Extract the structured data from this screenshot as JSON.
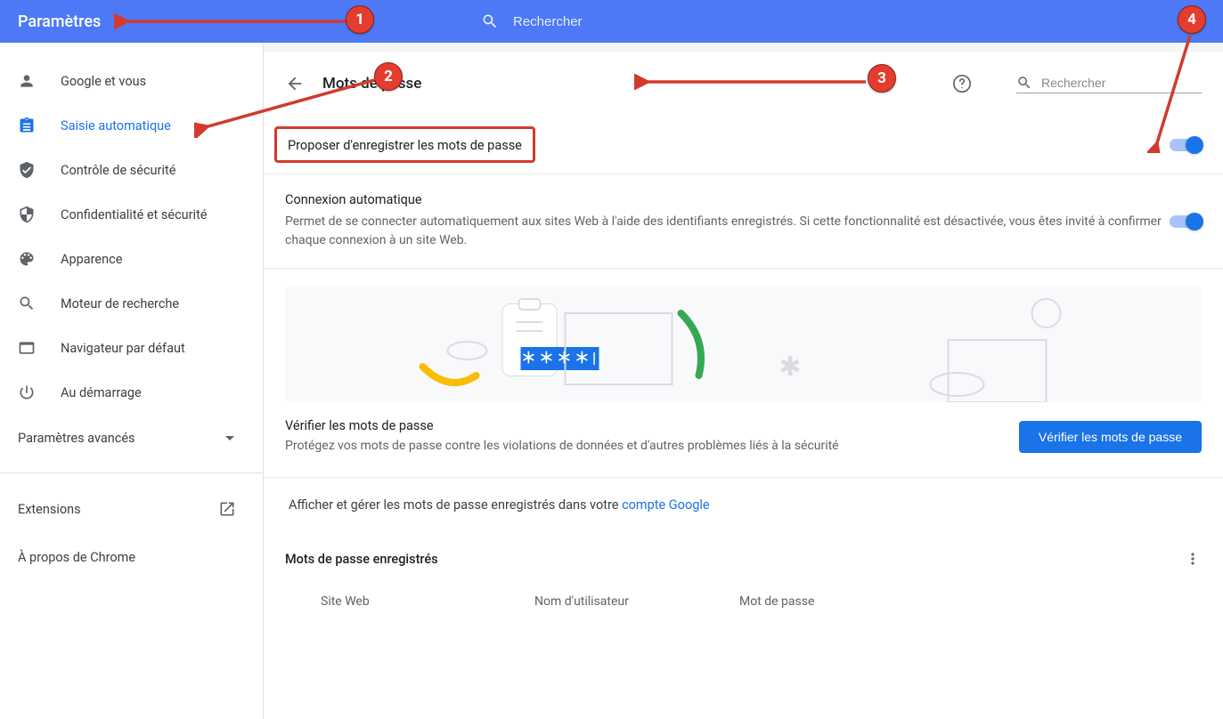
{
  "header": {
    "title": "Paramètres",
    "search_placeholder": "Rechercher"
  },
  "sidebar": {
    "items": [
      {
        "label": "Google et vous"
      },
      {
        "label": "Saisie automatique"
      },
      {
        "label": "Contrôle de sécurité"
      },
      {
        "label": "Confidentialité et sécurité"
      },
      {
        "label": "Apparence"
      },
      {
        "label": "Moteur de recherche"
      },
      {
        "label": "Navigateur par défaut"
      },
      {
        "label": "Au démarrage"
      }
    ],
    "advanced_label": "Paramètres avancés",
    "extensions_label": "Extensions",
    "about_label": "À propos de Chrome"
  },
  "content": {
    "title": "Mots de passe",
    "search_placeholder": "Rechercher",
    "offer_save_label": "Proposer d'enregistrer les mots de passe",
    "auto_signin": {
      "label": "Connexion automatique",
      "desc": "Permet de se connecter automatiquement aux sites Web à l'aide des identifiants enregistrés. Si cette fonctionnalité est désactivée, vous êtes invité à confirmer chaque connexion à un site Web."
    },
    "verify": {
      "title": "Vérifier les mots de passe",
      "desc": "Protégez vos mots de passe contre les violations de données et d'autres problèmes liés à la sécurité",
      "button": "Vérifier les mots de passe"
    },
    "google_account": {
      "prefix": "Afficher et gérer les mots de passe enregistrés dans votre ",
      "link": "compte Google"
    },
    "saved": {
      "title": "Mots de passe enregistrés",
      "col_site": "Site Web",
      "col_user": "Nom d'utilisateur",
      "col_pass": "Mot de passe"
    }
  },
  "markers": [
    "1",
    "2",
    "3",
    "4"
  ]
}
